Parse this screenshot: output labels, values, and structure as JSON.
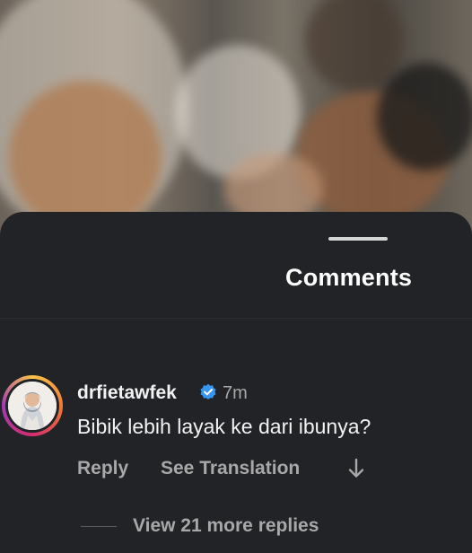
{
  "sheet": {
    "title": "Comments"
  },
  "comment": {
    "username": "drfietawfek",
    "verified": true,
    "time": "7m",
    "text": "Bibik lebih layak ke dari ibunya?",
    "reply_label": "Reply",
    "translate_label": "See Translation",
    "more_replies_label": "View 21 more replies"
  },
  "colors": {
    "sheet_bg": "#212327",
    "verified_blue": "#3897f0",
    "text_primary": "#f2f2f2",
    "text_secondary": "#a8a8a8"
  },
  "icons": {
    "verified": "verified-badge-icon",
    "arrow": "down-arrow-icon"
  }
}
